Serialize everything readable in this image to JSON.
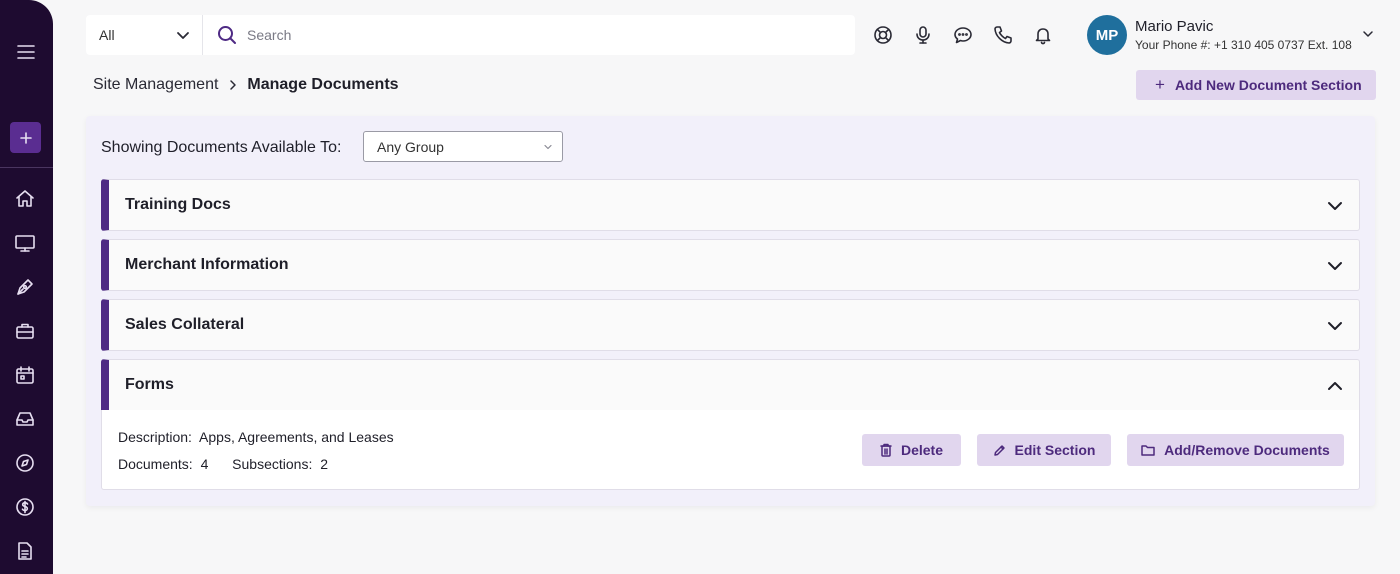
{
  "search": {
    "scope_value": "All",
    "placeholder": "Search"
  },
  "header_icons": [
    "lifebuoy-icon",
    "microphone-icon",
    "chat-icon",
    "phone-icon",
    "bell-icon"
  ],
  "user": {
    "initials": "MP",
    "name": "Mario Pavic",
    "phone": "Your Phone #: +1 310 405 0737 Ext. 108",
    "avatar_color": "#1f6f9d"
  },
  "sidebar": {
    "background": "#1e0b30",
    "accent": "#5a2d91",
    "icons": [
      "menu-icon",
      "plus-icon",
      "home-icon",
      "monitor-icon",
      "pen-icon",
      "briefcase-icon",
      "calendar-icon",
      "inbox-icon",
      "compass-icon",
      "dollar-icon",
      "document-icon"
    ]
  },
  "breadcrumb": {
    "root": "Site Management",
    "current": "Manage Documents"
  },
  "actions": {
    "add_section": "Add New Document Section"
  },
  "filter": {
    "label": "Showing Documents Available To:",
    "value": "Any Group"
  },
  "sections": [
    {
      "title": "Training Docs",
      "expanded": false
    },
    {
      "title": "Merchant Information",
      "expanded": false
    },
    {
      "title": "Sales Collateral",
      "expanded": false
    },
    {
      "title": "Forms",
      "expanded": true
    }
  ],
  "expanded": {
    "description_label": "Description:",
    "description": "Apps, Agreements, and Leases",
    "documents_label": "Documents:",
    "documents": "4",
    "subsections_label": "Subsections:",
    "subsections": "2",
    "delete_label": "Delete",
    "edit_label": "Edit Section",
    "add_remove_label": "Add/Remove Documents"
  },
  "colors": {
    "brand": "#4e2a84",
    "button_bg": "#e1d6ee",
    "button_text": "#4d2a7d",
    "panel_bg": "#f2f0fa"
  }
}
